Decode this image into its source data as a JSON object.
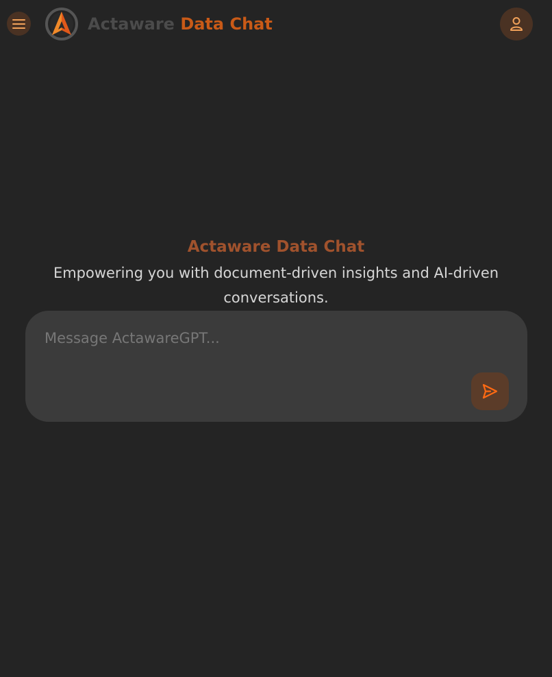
{
  "header": {
    "brand_part1": "Actaware",
    "brand_part2": "Data Chat",
    "menu_icon": "hamburger-menu-icon",
    "logo_icon": "actaware-logo-icon",
    "user_icon": "user-icon"
  },
  "hero": {
    "title": "Actaware Data Chat",
    "subtitle": "Empowering you with document-driven insights and AI-driven conversations."
  },
  "composer": {
    "placeholder": "Message ActawareGPT...",
    "value": "",
    "send_icon": "send-icon"
  },
  "colors": {
    "background": "#242424",
    "accent": "#c95a17",
    "accent_muted": "#a0522d",
    "button_bg": "#4a3223",
    "composer_bg": "#3b3b3b"
  }
}
